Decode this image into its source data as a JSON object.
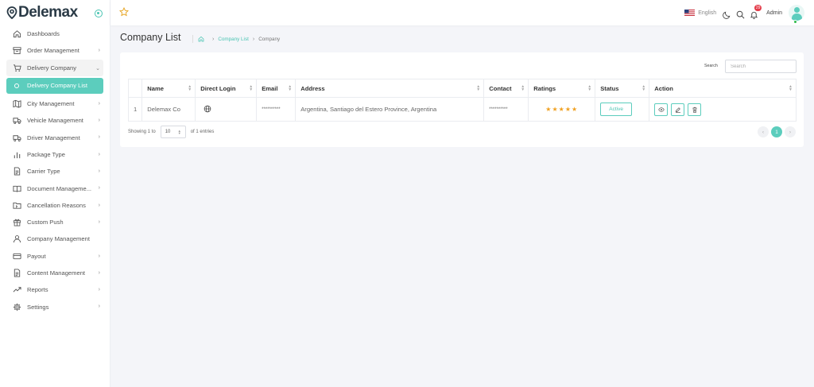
{
  "brand": {
    "name": "Delemax"
  },
  "colors": {
    "accent": "#5ccdbd",
    "accent_text": "#49c4b2",
    "badge": "#e43c4a",
    "star": "#f0a020"
  },
  "sidebar": {
    "items": [
      {
        "label": "Dashboards",
        "icon": "home-icon",
        "chevron": false
      },
      {
        "label": "Order Management",
        "icon": "archive-icon",
        "chevron": true
      },
      {
        "label": "Delivery Company",
        "icon": "cart-icon",
        "chevron": true,
        "open": true
      },
      {
        "label": "Delivery Company List",
        "icon": "circle-icon",
        "active": true
      },
      {
        "label": "City Management",
        "icon": "map-icon",
        "chevron": true
      },
      {
        "label": "Vehicle Management",
        "icon": "truck-icon",
        "chevron": true
      },
      {
        "label": "Driver Management",
        "icon": "truck-icon",
        "chevron": true
      },
      {
        "label": "Package Type",
        "icon": "chart-icon",
        "chevron": true
      },
      {
        "label": "Carrier Type",
        "icon": "document-icon",
        "chevron": true
      },
      {
        "label": "Document Manageme...",
        "icon": "book-icon",
        "chevron": true
      },
      {
        "label": "Cancellation Reasons",
        "icon": "folder-icon",
        "chevron": true
      },
      {
        "label": "Custom Push",
        "icon": "gift-icon",
        "chevron": true
      },
      {
        "label": "Company Management",
        "icon": "user-icon",
        "chevron": false
      },
      {
        "label": "Payout",
        "icon": "card-icon",
        "chevron": true
      },
      {
        "label": "Content Management",
        "icon": "document-icon",
        "chevron": true
      },
      {
        "label": "Reports",
        "icon": "trend-icon",
        "chevron": true
      },
      {
        "label": "Settings",
        "icon": "gear-icon",
        "chevron": true
      }
    ]
  },
  "header": {
    "language": "English",
    "notifications_count": "29",
    "user_name": "Admin"
  },
  "page": {
    "title": "Company List",
    "breadcrumb": [
      "Company List",
      "Company"
    ]
  },
  "table": {
    "search_label": "Search",
    "search_placeholder": "Search",
    "columns": [
      "",
      "Name",
      "Direct Login",
      "Email",
      "Address",
      "Contact",
      "Ratings",
      "Status",
      "Action"
    ],
    "rows": [
      {
        "index": "1",
        "name": "Delemax Co",
        "email": "**********",
        "address": "Argentina, Santiago del Estero Province, Argentina",
        "contact": "**********",
        "rating": "★★★★★",
        "rating_value": 5,
        "status": "Active"
      }
    ],
    "showing_prefix": "Showing 1 to",
    "page_length": "10",
    "showing_suffix": "of 1 entries",
    "current_page": "1"
  }
}
